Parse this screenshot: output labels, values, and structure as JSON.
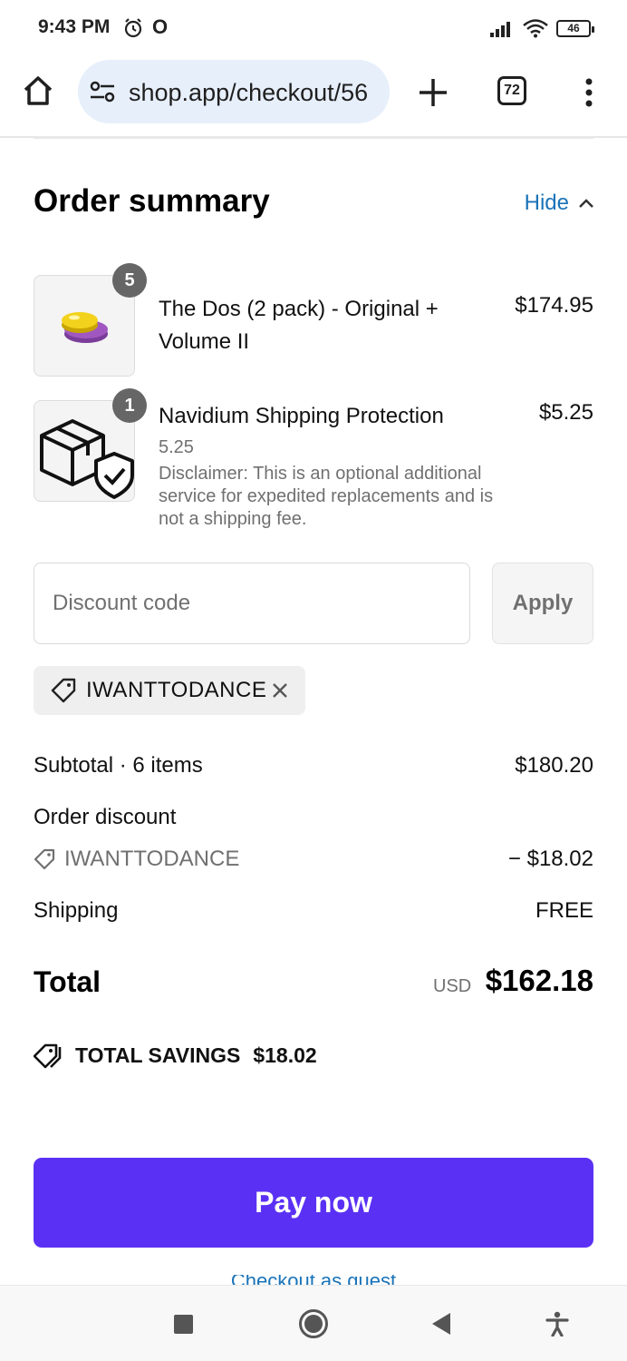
{
  "status_bar": {
    "time": "9:43 PM",
    "carrier_icon": "O",
    "battery_level": "46"
  },
  "browser": {
    "url": "shop.app/checkout/56",
    "tab_count": "72"
  },
  "summary": {
    "title": "Order summary",
    "toggle_label": "Hide"
  },
  "line_items": [
    {
      "name": "The Dos (2 pack) - Original + Volume II",
      "price": "$174.95",
      "quantity": "5"
    },
    {
      "name": "Navidium Shipping Protection",
      "price": "$5.25",
      "quantity": "1",
      "variant": "5.25",
      "note": "Disclaimer: This is an optional additional service for expedited replacements and is not a shipping fee."
    }
  ],
  "discount": {
    "placeholder": "Discount code",
    "value": "",
    "apply_label": "Apply",
    "applied_code": "IWANTTODANCE"
  },
  "totals": {
    "subtotal_label": "Subtotal · 6 items",
    "subtotal_value": "$180.20",
    "order_discount_label": "Order discount",
    "discount_code": "IWANTTODANCE",
    "discount_value": "− $18.02",
    "shipping_label": "Shipping",
    "shipping_value": "FREE",
    "total_label": "Total",
    "currency": "USD",
    "total_value": "$162.18",
    "savings_label": "TOTAL SAVINGS",
    "savings_value": "$18.02"
  },
  "actions": {
    "pay_label": "Pay now",
    "continue_label": "Checkout as guest"
  },
  "colors": {
    "accent": "#5a31f4",
    "link": "#1a73b8",
    "muted_text": "#707070"
  }
}
